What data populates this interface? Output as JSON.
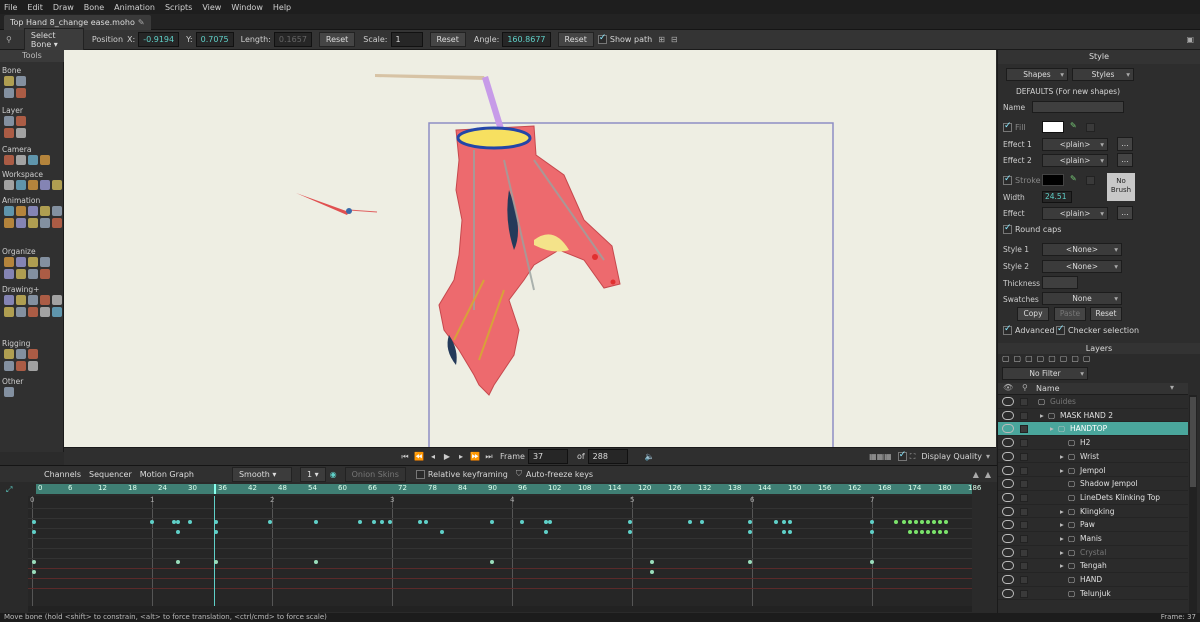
{
  "menu": [
    "File",
    "Edit",
    "Draw",
    "Bone",
    "Animation",
    "Scripts",
    "View",
    "Window",
    "Help"
  ],
  "tab": {
    "title": "Top Hand 8_change ease.moho",
    "modified_icon": "pencil-icon"
  },
  "toolopts": {
    "mode": "Select Bone",
    "position_label": "Position",
    "x_label": "X:",
    "x_value": "-0.9194",
    "y_label": "Y:",
    "y_value": "0.7075",
    "length_label": "Length:",
    "length_value": "0.1657",
    "reset1": "Reset",
    "scale_label": "Scale:",
    "scale_value": "1",
    "reset2": "Reset",
    "angle_label": "Angle:",
    "angle_value": "160.8677",
    "reset3": "Reset",
    "show_path": "Show path"
  },
  "tools": {
    "header": "Tools",
    "sections": [
      "Bone",
      "Layer",
      "Camera",
      "Workspace",
      "Animation",
      "Organize",
      "Drawing+",
      "Rigging",
      "Other"
    ]
  },
  "viewctrl": {
    "frame_label": "Frame",
    "frame_value": "37",
    "of_label": "of",
    "total_frames": "288",
    "display_quality": "Display Quality"
  },
  "style": {
    "title": "Style",
    "shapes": "Shapes",
    "styles": "Styles",
    "defaults": "DEFAULTS (For new shapes)",
    "name_label": "Name",
    "fill_label": "Fill",
    "fill_color": "#ffffff",
    "effect1_label": "Effect 1",
    "effect1": "<plain>",
    "effect2_label": "Effect 2",
    "effect2": "<plain>",
    "stroke_label": "Stroke",
    "stroke_color": "#000000",
    "no_brush": "No Brush",
    "width_label": "Width",
    "width_value": "24.51",
    "effect_label": "Effect",
    "effect": "<plain>",
    "round_caps": "Round caps",
    "style1_label": "Style 1",
    "style1": "<None>",
    "style2_label": "Style 2",
    "style2": "<None>",
    "thickness_label": "Thickness",
    "swatches_label": "Swatches",
    "swatches": "None",
    "copy": "Copy",
    "paste": "Paste",
    "reset": "Reset",
    "advanced": "Advanced",
    "checker": "Checker selection",
    "more": "..."
  },
  "layers": {
    "title": "Layers",
    "filter": "No Filter",
    "name_col": "Name",
    "rows": [
      {
        "name": "Guides",
        "dim": true,
        "indent": 0
      },
      {
        "name": "MASK HAND 2",
        "indent": 1
      },
      {
        "name": "HANDTOP",
        "sel": true,
        "indent": 2
      },
      {
        "name": "H2",
        "indent": 3
      },
      {
        "name": "Wrist",
        "indent": 3
      },
      {
        "name": "Jempol",
        "indent": 3
      },
      {
        "name": "Shadow Jempol",
        "indent": 3
      },
      {
        "name": "LineDets Klinking Top",
        "indent": 3
      },
      {
        "name": "Klingking",
        "indent": 3
      },
      {
        "name": "Paw",
        "indent": 3
      },
      {
        "name": "Manis",
        "indent": 3
      },
      {
        "name": "Crystal",
        "dim": true,
        "indent": 3
      },
      {
        "name": "Tengah",
        "indent": 3
      },
      {
        "name": "HAND",
        "indent": 3
      },
      {
        "name": "Telunjuk",
        "indent": 3
      }
    ]
  },
  "timeline": {
    "tabs": [
      "Channels",
      "Sequencer",
      "Motion Graph"
    ],
    "interp": "Smooth",
    "interp_num": "1",
    "onion": "Onion Skins",
    "relative": "Relative keyframing",
    "autofreeze": "Auto-freeze keys",
    "ruler": [
      "0",
      "6",
      "12",
      "18",
      "24",
      "30",
      "36",
      "42",
      "48",
      "54",
      "60",
      "66",
      "72",
      "78",
      "84",
      "90",
      "96",
      "102",
      "108",
      "114",
      "120",
      "126",
      "132",
      "138",
      "144",
      "150",
      "156",
      "162",
      "168",
      "174",
      "180",
      "186"
    ],
    "seconds": [
      "0",
      "1",
      "2",
      "3",
      "4",
      "5",
      "6",
      "7"
    ]
  },
  "status": {
    "hint": "Move bone (hold <shift> to constrain, <alt> to force translation, <ctrl/cmd> to force scale)",
    "frame": "Frame: 37"
  }
}
